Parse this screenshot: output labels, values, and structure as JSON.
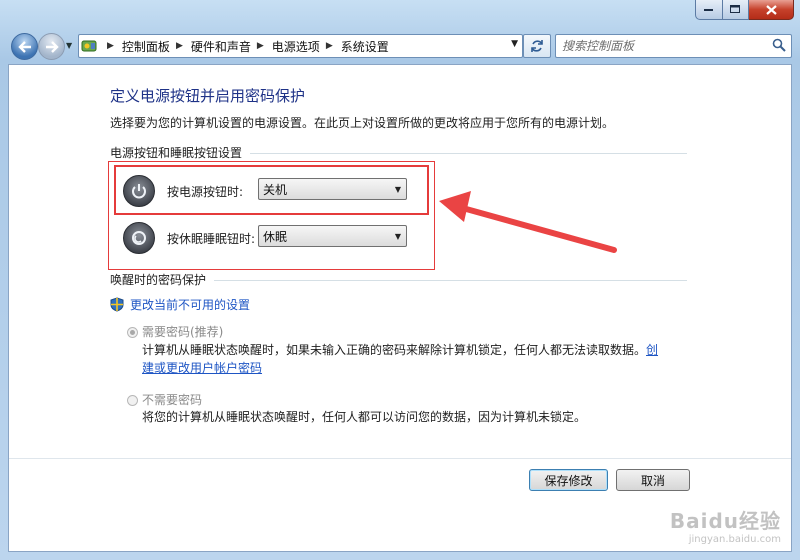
{
  "window": {
    "address_crumbs": [
      "控制面板",
      "硬件和声音",
      "电源选项",
      "系统设置"
    ],
    "search_placeholder": "搜索控制面板"
  },
  "main": {
    "title": "定义电源按钮并启用密码保护",
    "description": "选择要为您的计算机设置的电源设置。在此页上对设置所做的更改将应用于您所有的电源计划。",
    "power_section": {
      "heading": "电源按钮和睡眠按钮设置",
      "power_button_label": "按电源按钮时:",
      "power_button_value": "关机",
      "sleep_button_label": "按休眠睡眠钮时:",
      "sleep_button_value": "休眠"
    },
    "password_section": {
      "heading": "唤醒时的密码保护",
      "change_link": "更改当前不可用的设置",
      "option_require": {
        "label": "需要密码(推荐)",
        "desc_line1": "计算机从睡眠状态唤醒时，如果未输入正确的密码来解除计算机锁定，任何人都无法读取数据。",
        "link_part1": "创",
        "link_part2": "建或更改用户帐户密码",
        "selected": true
      },
      "option_no_require": {
        "label": "不需要密码",
        "desc": "将您的计算机从睡眠状态唤醒时，任何人都可以访问您的数据，因为计算机未锁定。",
        "selected": false
      }
    },
    "buttons": {
      "save": "保存修改",
      "cancel": "取消"
    }
  },
  "watermark": {
    "brand": "Baidu经验",
    "url": "jingyan.baidu.com"
  },
  "colors": {
    "title": "#1e3287",
    "link": "#1e55c4",
    "highlight": "#e53b3b"
  }
}
